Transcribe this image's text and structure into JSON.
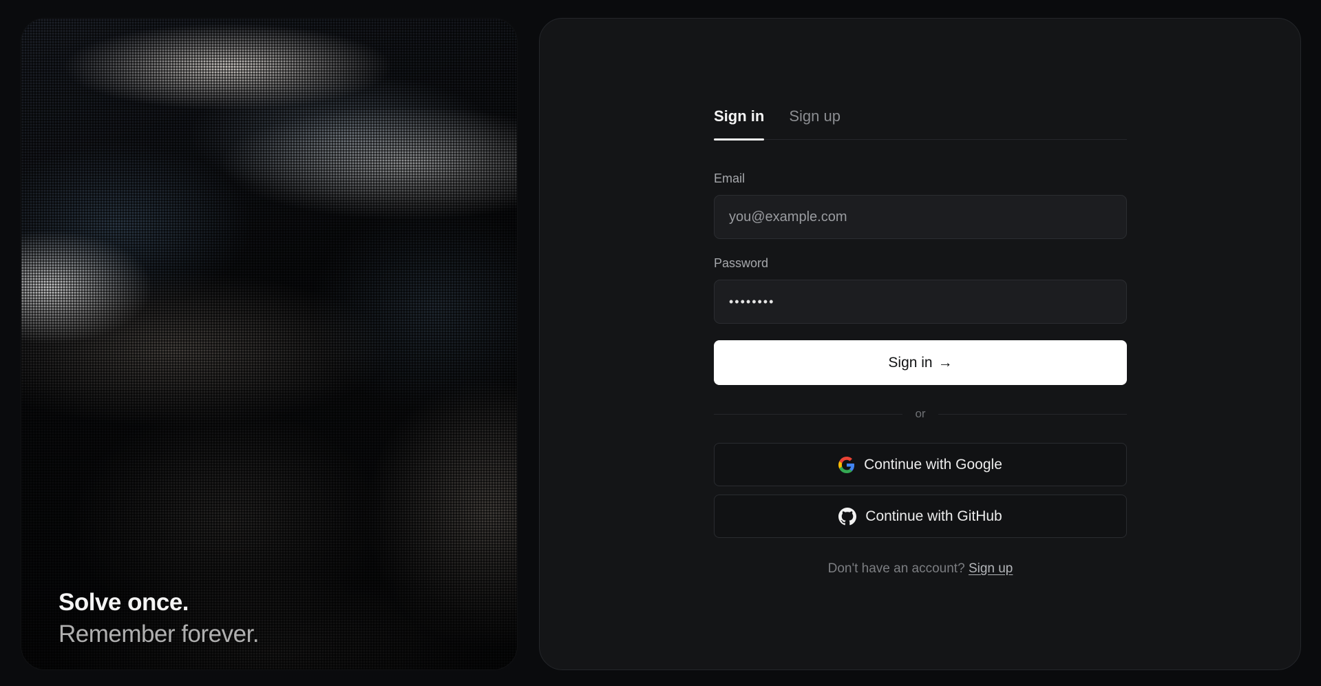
{
  "hero": {
    "headline": "Solve once.",
    "subheadline": "Remember forever."
  },
  "auth": {
    "tabs": [
      {
        "label": "Sign in",
        "active": true
      },
      {
        "label": "Sign up",
        "active": false
      }
    ],
    "email": {
      "label": "Email",
      "placeholder": "you@example.com",
      "value": ""
    },
    "password": {
      "label": "Password",
      "value": "••••••••"
    },
    "submit_label": "Sign in",
    "submit_arrow": "→",
    "divider_text": "or",
    "google_label": "Continue with Google",
    "github_label": "Continue with GitHub",
    "footer_prompt": "Don't have an account?",
    "footer_link": "Sign up"
  },
  "icons": {
    "google": "google-icon",
    "github": "github-icon"
  },
  "colors": {
    "background": "#0a0b0d",
    "panel": "#141517",
    "primary_button": "#ffffff",
    "google_blue": "#4285F4",
    "google_red": "#EA4335",
    "google_yellow": "#FBBC05",
    "google_green": "#34A853"
  }
}
